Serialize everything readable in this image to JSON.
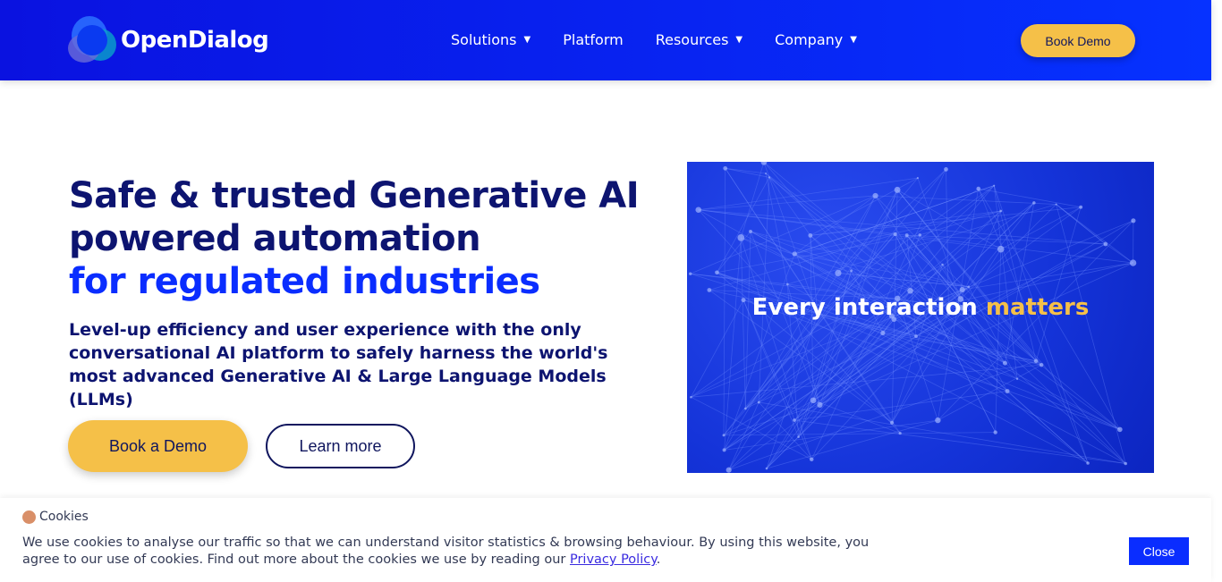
{
  "nav": {
    "brand": "OpenDialog",
    "items": [
      {
        "label": "Solutions",
        "dropdown": true
      },
      {
        "label": "Platform",
        "dropdown": false
      },
      {
        "label": "Resources",
        "dropdown": true
      },
      {
        "label": "Company",
        "dropdown": true
      }
    ],
    "cta": "Book Demo"
  },
  "hero": {
    "title_line1": "Safe & trusted Generative AI",
    "title_line2": "powered automation",
    "title_line3": "for regulated industries",
    "subtitle": "Level-up efficiency and user experience with the only conversational AI platform to safely harness the world's most advanced Generative AI & Large Language Models (LLMs)",
    "primary_button": "Book a Demo",
    "secondary_button": "Learn more",
    "image_text": "Every interaction",
    "image_text_highlight": "matters"
  },
  "cookies": {
    "title": "Cookies",
    "text": "We use cookies to analyse our traffic so that we can understand visitor statistics & browsing behaviour. By using this website, you agree to our use of cookies. Find out more about the cookies we use by reading our ",
    "link": "Privacy Policy",
    "text_end": ".",
    "close": "Close"
  },
  "colors": {
    "nav": "#0a12e0",
    "accent": "#f5c048",
    "navy": "#0d1470",
    "blue": "#0a2dff"
  }
}
